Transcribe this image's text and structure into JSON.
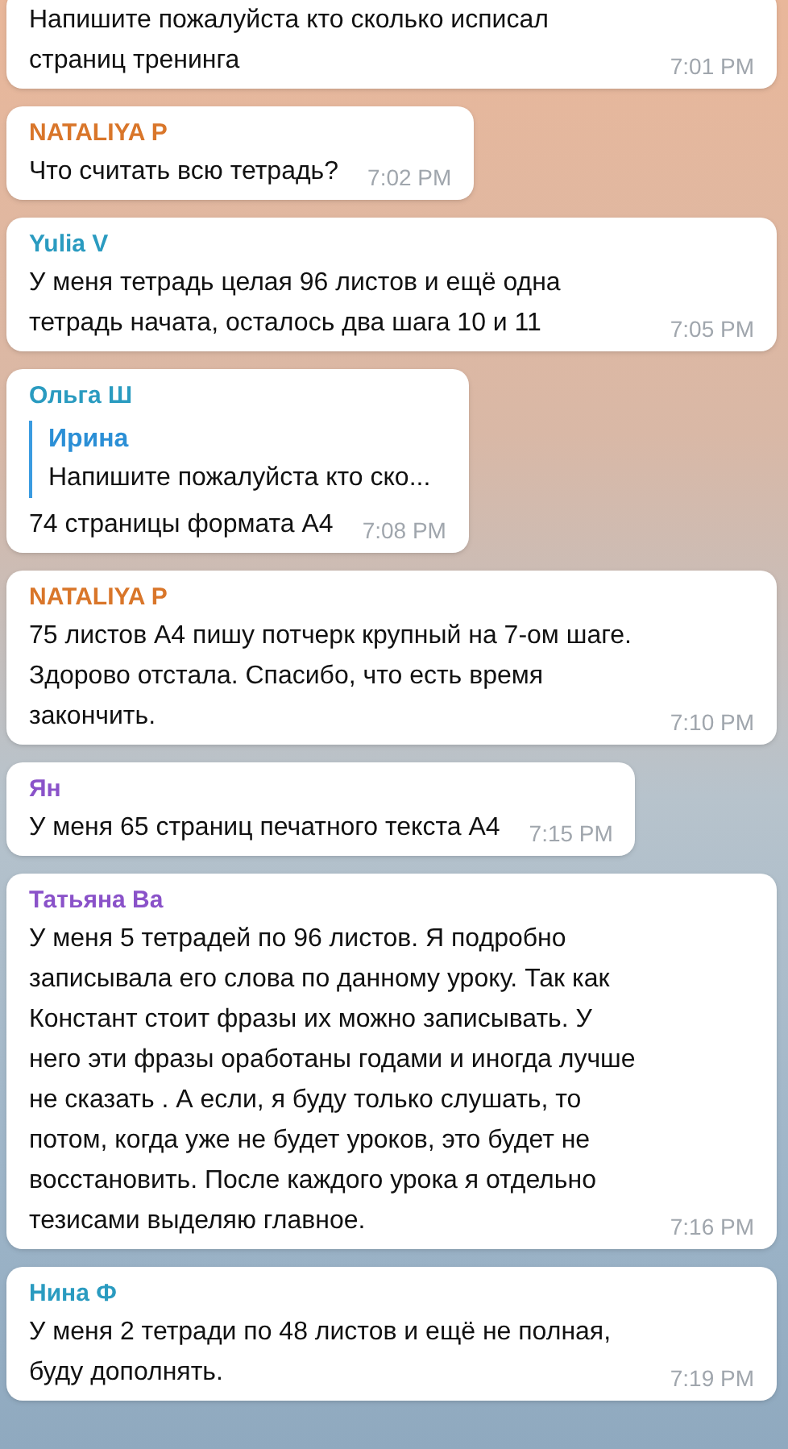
{
  "messages": [
    {
      "text": "Напишите пожалуйста кто сколько исписал страниц тренинга",
      "time": "7:01 PM"
    },
    {
      "sender": "NATALIYA P",
      "color": "#d9762a",
      "text": "Что считать всю тетрадь?",
      "time": "7:02 PM"
    },
    {
      "sender": "Yulia V",
      "color": "#2a9bc0",
      "text": "У меня тетрадь целая 96 листов и ещё одна тетрадь начата, осталось два шага 10 и 11",
      "time": "7:05 PM"
    },
    {
      "sender": "Ольга Ш",
      "color": "#2a9bc0",
      "reply": {
        "name": "Ирина",
        "text": "Напишите пожалуйста кто ско..."
      },
      "text": "74 страницы формата А4",
      "time": "7:08 PM"
    },
    {
      "sender": "NATALIYA P",
      "color": "#d9762a",
      "text": "75 листов А4 пишу потчерк крупный  на 7-ом шаге. Здорово отстала. Спасибо, что есть время закончить.",
      "time": "7:10 PM"
    },
    {
      "sender": "Ян",
      "color": "#8a52c9",
      "text": "У меня 65 страниц печатного текста А4",
      "time": "7:15 PM"
    },
    {
      "sender": "Татьяна Ва",
      "color": "#8a52c9",
      "text": "У меня 5 тетрадей по 96 листов. Я подробно записывала его слова по данному уроку. Так как Констант стоит фразы их можно записывать. У него эти фразы  оработаны годами и иногда лучше не сказать . А если, я буду только слушать, то потом, когда уже не будет уроков, это будет не восстановить. После каждого урока я отдельно тезисами выделяю главное.",
      "time": "7:16 PM"
    },
    {
      "sender": "Нина Ф",
      "color": "#2a9bc0",
      "text": "У меня 2 тетради по 48 листов и ещё не полная,  буду дополнять.",
      "time": "7:19 PM"
    }
  ]
}
